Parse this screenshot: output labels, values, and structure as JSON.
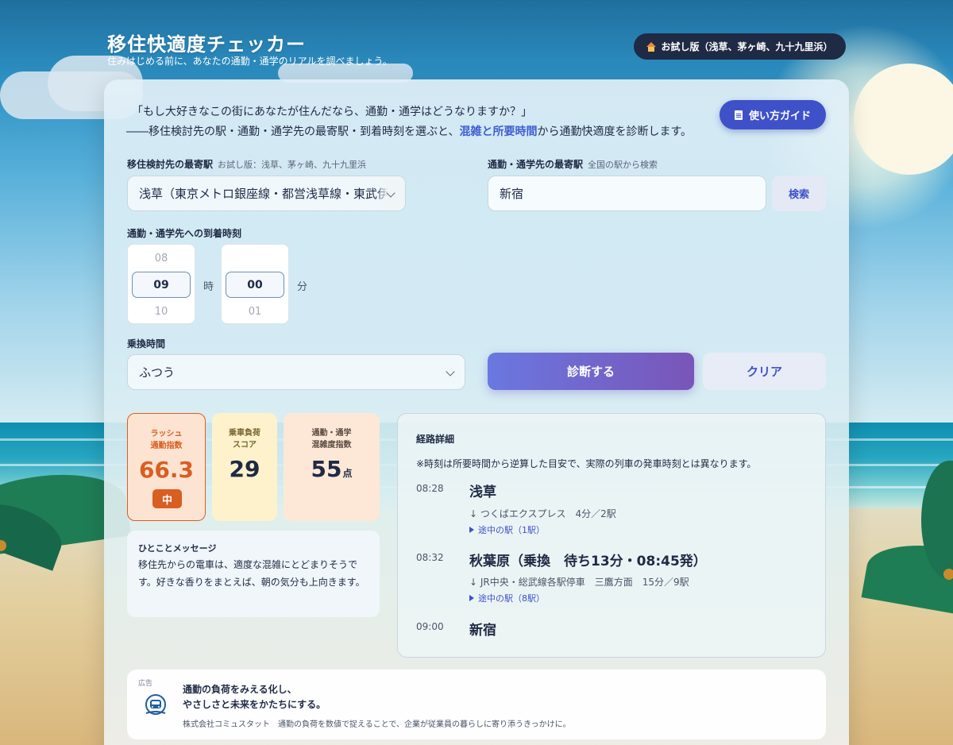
{
  "header": {
    "title": "移住快適度チェッカー",
    "subtitle": "住みはじめる前に、あなたの通勤・通学のリアルを調べましょう。",
    "trial_label": "お試し版（浅草、茅ヶ崎、九十九里浜）"
  },
  "intro": {
    "line1": "「もし大好きなこの街にあなたが住んだなら、通勤・通学はどうなりますか？」",
    "line2_prefix": "――移住検討先の駅・通勤・通学先の最寄駅・到着時刻を選ぶと、",
    "line2_highlight": "混雑と所要時間",
    "line2_suffix": "から通勤快適度を診断します。",
    "guide_button": "使い方ガイド"
  },
  "form": {
    "origin": {
      "label": "移住検討先の最寄駅",
      "hint": "お試し版：浅草、茅ヶ崎、九十九里浜",
      "value": "浅草（東京メトロ銀座線・都営浅草線・東武伊勢崎線）"
    },
    "destination": {
      "label": "通勤・通学先の最寄駅",
      "hint": "全国の駅から検索",
      "value": "新宿",
      "search_button": "検索"
    },
    "arrival": {
      "label": "通勤・通学先への到着時刻",
      "hour_prev": "08",
      "hour": "09",
      "hour_next": "10",
      "hour_unit": "時",
      "minute_prev": "",
      "minute": "00",
      "minute_next": "01",
      "minute_unit": "分"
    },
    "transfer": {
      "label": "乗換時間",
      "value": "ふつう"
    },
    "diagnose_button": "診断する",
    "clear_button": "クリア"
  },
  "scores": {
    "rush": {
      "label_line1": "ラッシュ",
      "label_line2": "通勤指数",
      "value": "66.3",
      "badge": "中"
    },
    "load": {
      "label_line1": "乗車負荷",
      "label_line2": "スコア",
      "value": "29"
    },
    "crowd": {
      "label_line1": "通勤・通学",
      "label_line2": "混雑度指数",
      "value": "55",
      "unit": "点"
    }
  },
  "message": {
    "title": "ひとことメッセージ",
    "body": "移住先からの電車は、適度な混雑にとどまりそうです。好きな香りをまとえば、朝の気分も上向きます。"
  },
  "route": {
    "title": "経路詳細",
    "note": "※時刻は所要時間から逆算した目安で、実際の列車の発車時刻とは異なります。",
    "steps": [
      {
        "time": "08:28",
        "station": "浅草",
        "line": "↓ つくばエクスプレス　4分／2駅",
        "mid": "途中の駅（1駅）"
      },
      {
        "time": "08:32",
        "station": "秋葉原（乗換　待ち13分・08:45発）",
        "line": "↓ JR中央・総武線各駅停車　三鷹方面　15分／9駅",
        "mid": "途中の駅（8駅）"
      },
      {
        "time": "09:00",
        "station": "新宿"
      }
    ]
  },
  "ad": {
    "tag": "広告",
    "headline_line1": "通勤の負荷をみえる化し、",
    "headline_line2": "やさしさと未来をかたちにする。",
    "description": "株式会社コミュスタット　通勤の負荷を数値で捉えることで、企業が従業員の暮らしに寄り添うきっかけに。",
    "icon": "train-icon"
  },
  "colors": {
    "accent": "#3e51c9",
    "rush": "#d85e22",
    "dark": "#1f2a44"
  }
}
